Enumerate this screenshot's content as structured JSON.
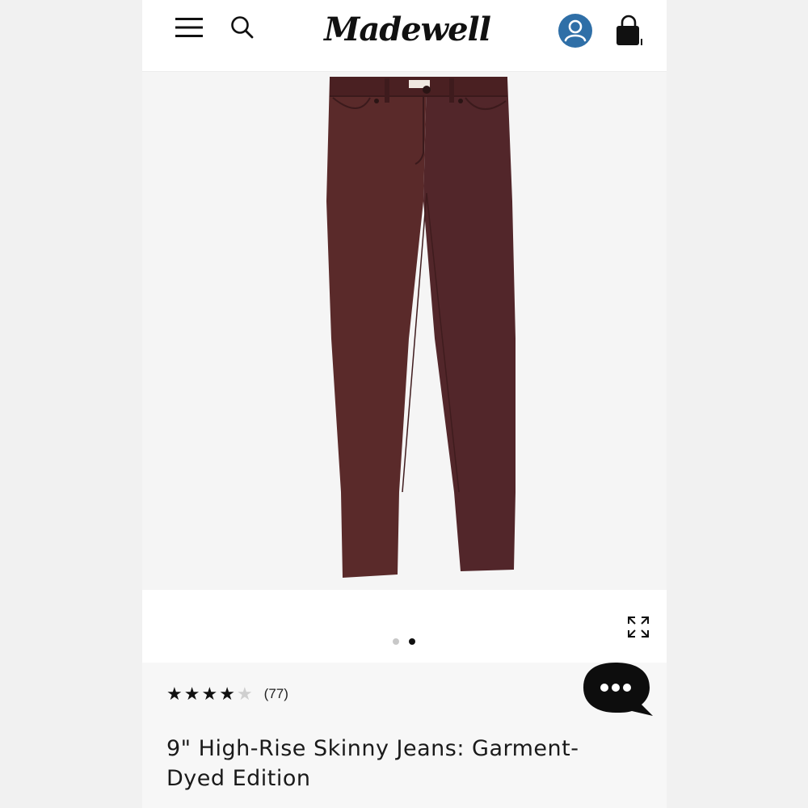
{
  "header": {
    "logo_text": "Madewell",
    "icons": [
      "menu-icon",
      "search-icon",
      "account-icon",
      "shopping-bag-icon"
    ],
    "account_color": "#2f6fa7"
  },
  "gallery": {
    "image_alt": "burgundy skinny jeans",
    "dots_count": 2,
    "active_dot": 2,
    "expand_icon": "expand-icon"
  },
  "product": {
    "rating_value": 4,
    "rating_max": 5,
    "review_count": "(77)",
    "title": "9\" High-Rise Skinny Jeans: Garment-Dyed Edition"
  },
  "chat": {
    "icon": "chat-bubble-icon"
  },
  "colors": {
    "jeans": "#5a2a2a",
    "background": "#f1f1f1"
  }
}
